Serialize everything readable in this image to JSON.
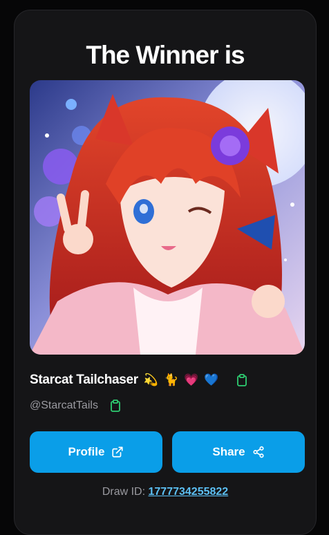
{
  "header": {
    "title": "The Winner is"
  },
  "winner": {
    "display_name": "Starcat Tailchaser",
    "emojis": [
      "💫",
      "🐈",
      "💗",
      "💙"
    ],
    "handle": "@StarcatTails",
    "avatar_icon": "anime-catgirl-portrait"
  },
  "actions": {
    "profile_label": "Profile",
    "share_label": "Share"
  },
  "draw": {
    "label": "Draw ID:",
    "id": "1777734255822"
  },
  "colors": {
    "accent": "#0a9ee8",
    "clipboard": "#2ecc71",
    "link": "#5cc0f5",
    "card_bg": "#151517"
  }
}
